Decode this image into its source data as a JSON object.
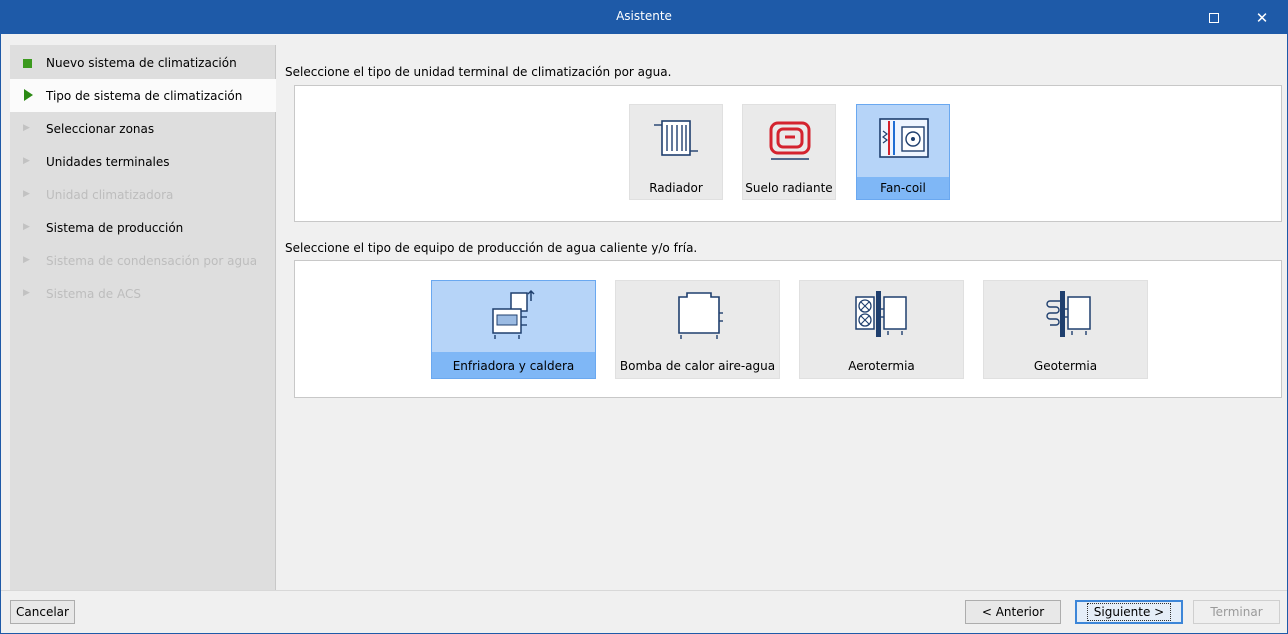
{
  "window": {
    "title": "Asistente"
  },
  "titlebar": {
    "maximize_icon": "maximize-icon",
    "close_icon": "close-icon",
    "close_glyph": "✕"
  },
  "sidebar": {
    "steps": [
      {
        "label": "Nuevo sistema de climatización",
        "state": "done",
        "icon": "green-square-icon"
      },
      {
        "label": "Tipo de sistema de climatización",
        "state": "current",
        "icon": "green-arrow-icon"
      },
      {
        "label": "Seleccionar zonas",
        "state": "pending",
        "icon": "dim-arrow-icon"
      },
      {
        "label": "Unidades terminales",
        "state": "pending",
        "icon": "dim-arrow-icon"
      },
      {
        "label": "Unidad climatizadora",
        "state": "disabled",
        "icon": "dim-arrow-icon"
      },
      {
        "label": "Sistema de producción",
        "state": "pending",
        "icon": "dim-arrow-icon"
      },
      {
        "label": "Sistema de condensación por agua",
        "state": "disabled",
        "icon": "dim-arrow-icon"
      },
      {
        "label": "Sistema de ACS",
        "state": "disabled",
        "icon": "dim-arrow-icon"
      }
    ]
  },
  "terminal_section": {
    "prompt": "Seleccione el tipo de unidad terminal de climatización por agua.",
    "options": [
      {
        "label": "Radiador",
        "icon": "radiator-icon",
        "selected": false
      },
      {
        "label": "Suelo radiante",
        "icon": "underfloor-heating-icon",
        "selected": false
      },
      {
        "label": "Fan-coil",
        "icon": "fan-coil-icon",
        "selected": true
      }
    ]
  },
  "production_section": {
    "prompt": "Seleccione el tipo de equipo de producción de agua caliente y/o fría.",
    "options": [
      {
        "label": "Enfriadora y caldera",
        "icon": "chiller-boiler-icon",
        "selected": true
      },
      {
        "label": "Bomba de calor aire-agua",
        "icon": "air-water-heat-pump-icon",
        "selected": false
      },
      {
        "label": "Aerotermia",
        "icon": "aerothermal-icon",
        "selected": false
      },
      {
        "label": "Geotermia",
        "icon": "geothermal-icon",
        "selected": false
      }
    ]
  },
  "footer": {
    "cancel_label": "Cancelar",
    "back_label": "< Anterior",
    "next_label": "Siguiente >",
    "finish_label": "Terminar"
  }
}
